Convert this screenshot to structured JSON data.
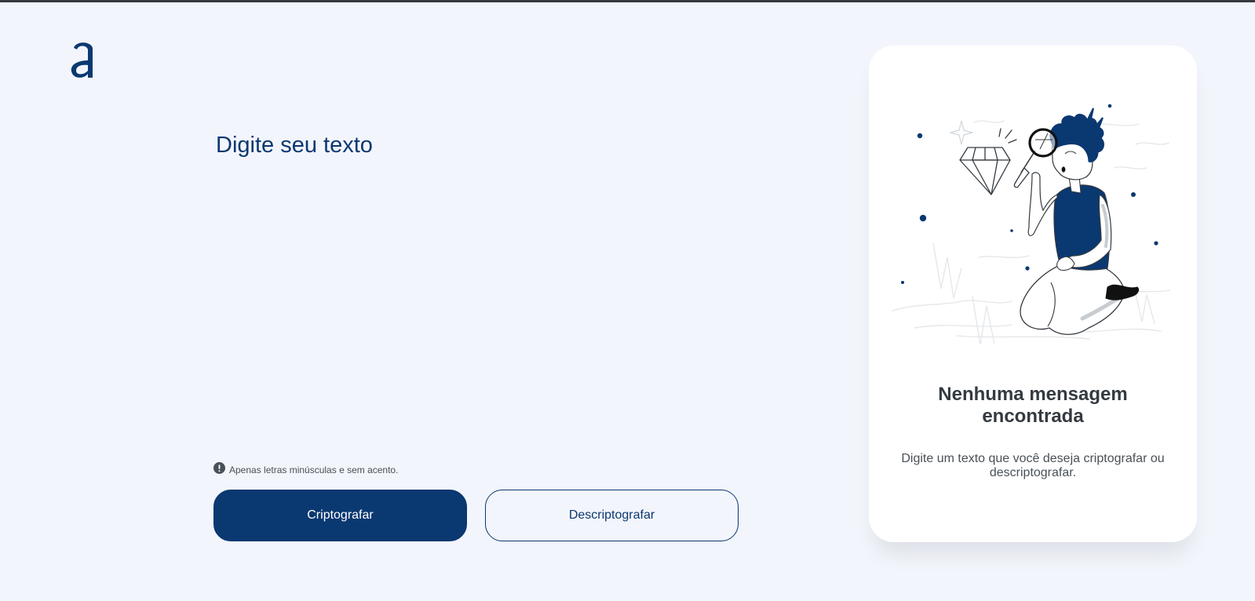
{
  "brand": {
    "logo_letter": "a",
    "color": "#0a3871"
  },
  "input": {
    "placeholder": "Digite seu texto",
    "value": ""
  },
  "hint": {
    "icon": "exclamation-circle-icon",
    "text": "Apenas letras minúsculas e sem acento."
  },
  "buttons": {
    "encrypt_label": "Criptografar",
    "decrypt_label": "Descriptografar"
  },
  "output": {
    "illustration": "person-with-magnifying-glass-and-diamond",
    "title": "Nenhuma mensagem encontrada",
    "description": "Digite um texto que você deseja criptografar ou descriptografar."
  },
  "colors": {
    "background": "#f3f5fc",
    "primary": "#0a3871",
    "card": "#ffffff",
    "title_text": "#343a40",
    "body_text": "#495057"
  }
}
